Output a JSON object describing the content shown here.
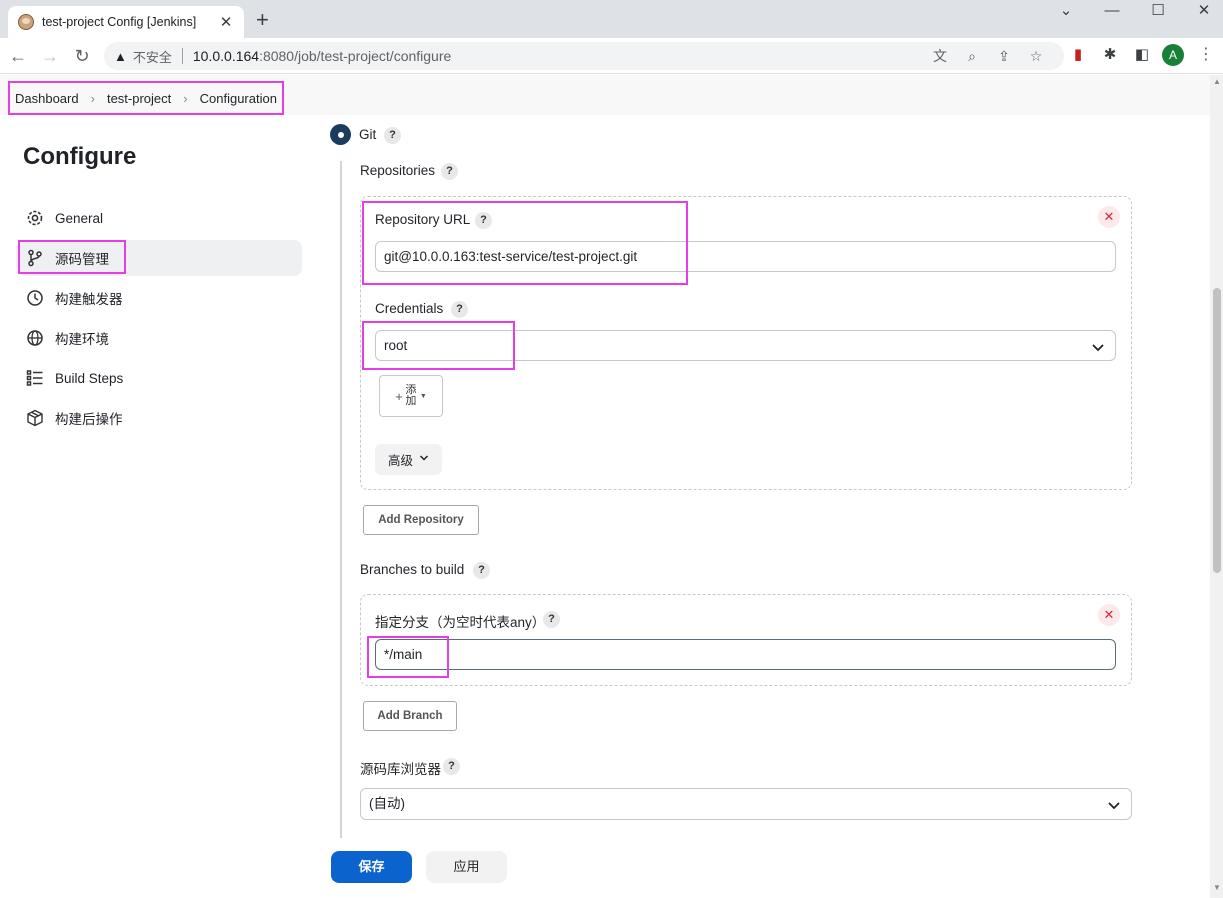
{
  "browser": {
    "tab_title": "test-project Config [Jenkins]",
    "tab_close": "✕",
    "new_tab": "+",
    "insecure_label": "不安全",
    "url_host": "10.0.0.164",
    "url_rest": ":8080/job/test-project/configure",
    "avatar_letter": "A"
  },
  "breadcrumb": {
    "items": [
      "Dashboard",
      "test-project",
      "Configuration"
    ]
  },
  "sidebar": {
    "title": "Configure",
    "items": [
      {
        "label": "General",
        "icon": "gear-icon"
      },
      {
        "label": "源码管理",
        "icon": "branch-icon",
        "active": true
      },
      {
        "label": "构建触发器",
        "icon": "clock-icon"
      },
      {
        "label": "构建环境",
        "icon": "globe-icon"
      },
      {
        "label": "Build Steps",
        "icon": "list-icon"
      },
      {
        "label": "构建后操作",
        "icon": "package-icon"
      }
    ]
  },
  "scm": {
    "git_label": "Git",
    "repositories_label": "Repositories",
    "repo_url_label": "Repository URL",
    "repo_url_value": "git@10.0.0.163:test-service/test-project.git",
    "credentials_label": "Credentials",
    "credentials_value": "root",
    "add_button_line1": "添",
    "add_button_line2": "加",
    "advanced_label": "高级",
    "add_repository_label": "Add Repository",
    "branches_label": "Branches to build",
    "branch_specifier_label": "指定分支（为空时代表any）",
    "branch_value": "*/main",
    "add_branch_label": "Add Branch",
    "repo_browser_label": "源码库浏览器",
    "repo_browser_value": "(自动)"
  },
  "footer": {
    "save_label": "保存",
    "apply_label": "应用"
  },
  "help_glyph": "?",
  "colors": {
    "highlight": "#e63ee6",
    "save_button": "#0b63ce",
    "radio": "#1b3b5f",
    "delete": "#d9273e"
  }
}
